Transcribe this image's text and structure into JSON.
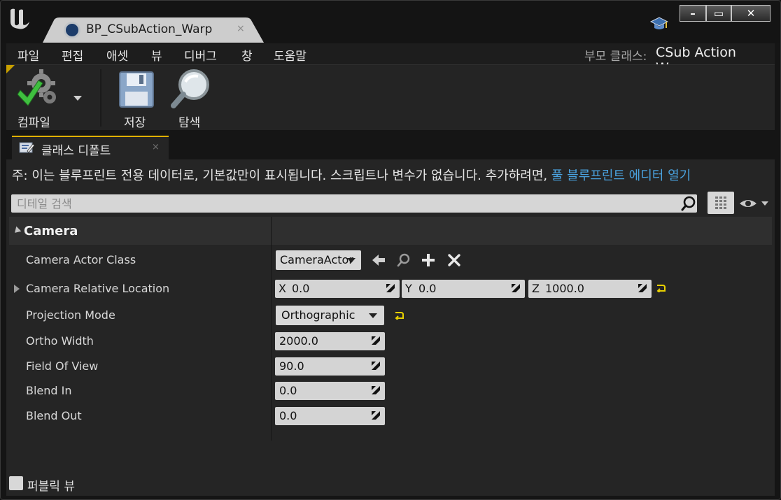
{
  "titlebar": {
    "tab_title": "BP_CSubAction_Warp",
    "tab_close": "×",
    "window_minimize": "–",
    "window_restore": "▭",
    "window_close": "✕"
  },
  "menu": {
    "items": [
      "파일",
      "편집",
      "애셋",
      "뷰",
      "디버그",
      "창",
      "도움말"
    ],
    "parent_class_label": "부모 클래스:",
    "parent_class_value": "CSub Action Warp"
  },
  "toolbar": {
    "compile_label": "컴파일",
    "save_label": "저장",
    "browse_label": "탐색"
  },
  "panel_tab": {
    "label": "클래스 디폴트",
    "close": "×"
  },
  "details": {
    "notice_text": "주: 이는 블루프린트 전용 데이터로, 기본값만이 표시됩니다. 스크립트나 변수가 없습니다. 추가하려면, ",
    "notice_link": "풀 블루프린트 에디터 열기",
    "search_placeholder": "디테일 검색",
    "category": "Camera",
    "properties": {
      "camera_actor_class": {
        "label": "Camera Actor Class",
        "value": "CameraActor"
      },
      "relative_location": {
        "label": "Camera Relative Location",
        "x_axis": "X",
        "x_value": "0.0",
        "y_axis": "Y",
        "y_value": "0.0",
        "z_axis": "Z",
        "z_value": "1000.0"
      },
      "projection_mode": {
        "label": "Projection Mode",
        "value": "Orthographic"
      },
      "ortho_width": {
        "label": "Ortho Width",
        "value": "2000.0"
      },
      "field_of_view": {
        "label": "Field Of View",
        "value": "90.0"
      },
      "blend_in": {
        "label": "Blend In",
        "value": "0.0"
      },
      "blend_out": {
        "label": "Blend Out",
        "value": "0.0"
      }
    }
  },
  "footer": {
    "public_view_label": "퍼블릭 뷰"
  },
  "colors": {
    "accent_link": "#4aa3e0",
    "tab_highlight": "#e0b000",
    "reset_arrow": "#e8d000"
  }
}
